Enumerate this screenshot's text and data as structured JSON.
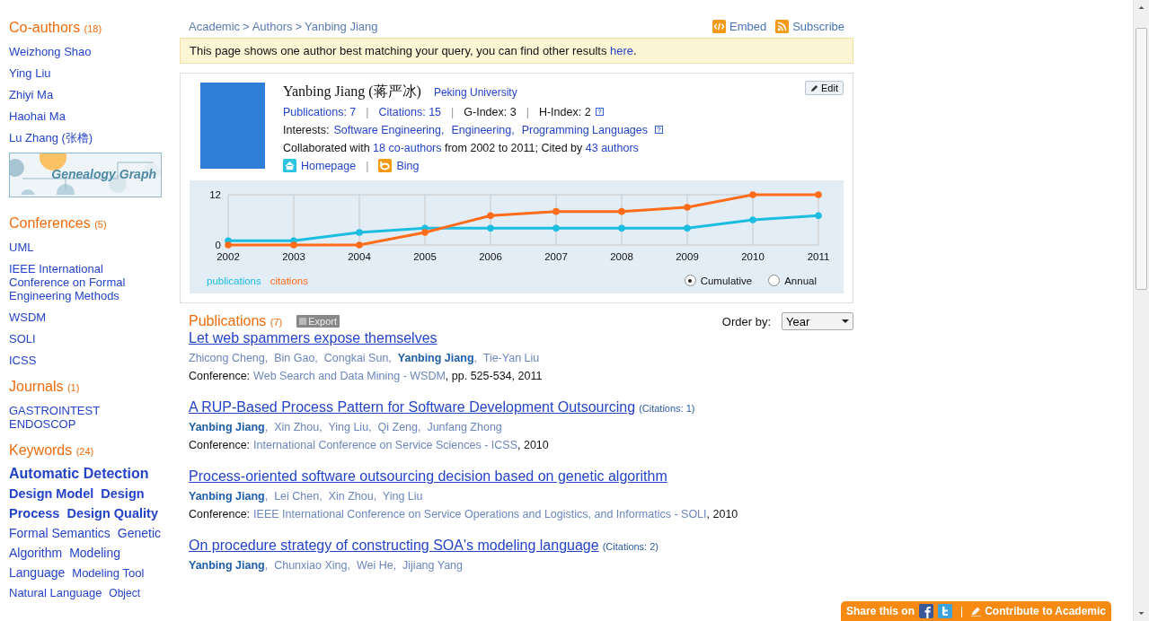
{
  "sidebar": {
    "coauthors": {
      "title": "Co-authors",
      "count": "(18)",
      "items": [
        "Weizhong Shao",
        "Ying Liu",
        "Zhiyi Ma",
        "Haohai Ma",
        "Lu Zhang (张橹)"
      ]
    },
    "genealogy": {
      "label": "Genealogy Graph"
    },
    "conferences": {
      "title": "Conferences",
      "count": "(5)",
      "items": [
        "UML",
        "IEEE International Conference on Formal Engineering Methods",
        "WSDM",
        "SOLI",
        "ICSS"
      ]
    },
    "journals": {
      "title": "Journals",
      "count": "(1)",
      "items": [
        "GASTROINTEST ENDOSCOP"
      ]
    },
    "keywords": {
      "title": "Keywords",
      "count": "(24)",
      "items": [
        {
          "text": "Automatic Detection",
          "kind": "xl"
        },
        {
          "text": "Design Model",
          "kind": "bold"
        },
        {
          "text": "Design",
          "kind": "bold"
        },
        {
          "text": "Process",
          "kind": "bold"
        },
        {
          "text": "Design Quality",
          "kind": "bold"
        },
        {
          "text": "Formal Semantics",
          "kind": "medium"
        },
        {
          "text": "Genetic",
          "kind": "medium"
        },
        {
          "text": "Algorithm",
          "kind": "medium"
        },
        {
          "text": "Modeling",
          "kind": "medium"
        },
        {
          "text": "Language",
          "kind": "medium"
        },
        {
          "text": "Modeling Tool",
          "kind": "small"
        },
        {
          "text": "Natural Language",
          "kind": "small"
        },
        {
          "text": "Object",
          "kind": "tiny"
        }
      ]
    }
  },
  "breadcrumb": {
    "items": [
      "Academic",
      "Authors",
      "Yanbing Jiang"
    ],
    "separator": ">"
  },
  "actions": [
    "Embed",
    "Subscribe"
  ],
  "notice": [
    {
      "kind": "text",
      "text": "This page shows one author best matching your query, you can find other results "
    },
    {
      "kind": "link",
      "text": "here"
    },
    {
      "kind": "text",
      "text": "."
    }
  ],
  "author": {
    "name": "Yanbing Jiang (蒋严冰)",
    "affiliation": "Peking University",
    "edit": "Edit",
    "stats": [
      {
        "text": "Publications: 7",
        "link": true
      },
      {
        "text": "Citations: 15",
        "link": true
      },
      {
        "text": "G-Index: 3",
        "link": false
      },
      {
        "text": "H-Index: 2",
        "link": false
      }
    ],
    "separator": "|",
    "interests_label": "Interests:",
    "interests": [
      "Software Engineering,",
      "Engineering,",
      "Programming Languages"
    ],
    "collab": [
      {
        "kind": "text",
        "text": "Collaborated with "
      },
      {
        "kind": "link",
        "text": "18 co-authors"
      },
      {
        "kind": "text",
        "text": " from 2002 to 2011; Cited by "
      },
      {
        "kind": "link",
        "text": "43 authors"
      }
    ],
    "links": [
      "Homepage",
      "Bing"
    ]
  },
  "chart": {
    "chart_data": {
      "type": "line",
      "x": [
        "2002",
        "2003",
        "2004",
        "2005",
        "2006",
        "2007",
        "2008",
        "2009",
        "2010",
        "2011"
      ],
      "ylim": [
        0,
        12
      ],
      "yticks": [
        0,
        12
      ],
      "grid": true,
      "series": [
        {
          "name": "publications",
          "color": "#1bbde0",
          "marker": true,
          "values": [
            1,
            1,
            3,
            4,
            4,
            4,
            4,
            4,
            6,
            7
          ]
        },
        {
          "name": "citations",
          "color": "#ff6c1a",
          "marker": true,
          "values": [
            0,
            0,
            0,
            3,
            7,
            8,
            8,
            9,
            12,
            12
          ]
        }
      ]
    },
    "modes": [
      {
        "label": "Cumulative",
        "selected": true
      },
      {
        "label": "Annual",
        "selected": false
      }
    ]
  },
  "publications": {
    "title": "Publications",
    "count": "(7)",
    "export": "Export",
    "order_label": "Order by:",
    "order_value": "Year",
    "items": [
      {
        "title": "Let web spammers expose themselves",
        "authors": "Zhicong Cheng,  Bin Gao,  Congkai Sun,  **Yanbing Jiang**,  Tie-Yan Liu",
        "venue_label": "Conference:",
        "venue": "Web Search and Data Mining - WSDM",
        "details": ", pp. 525-534, 2011"
      },
      {
        "title": "A RUP-Based Process Pattern for Software Development Outsourcing",
        "citations": "(Citations: 1)",
        "authors": "**Yanbing Jiang**,  Xin Zhou,  Ying Liu,  Qi Zeng,  Junfang Zhong",
        "venue_label": "Conference:",
        "venue": "International Conference on Service Sciences - ICSS",
        "details": ", 2010"
      },
      {
        "title": "Process-oriented software outsourcing decision based on genetic algorithm",
        "authors": "**Yanbing Jiang**,  Lei Chen,  Xin Zhou,  Ying Liu",
        "venue_label": "Conference:",
        "venue": "IEEE International Conference on Service Operations and Logistics, and Informatics - SOLI",
        "details": ", 2010"
      },
      {
        "title": "On procedure strategy of constructing SOA's modeling language",
        "citations": "(Citations: 2)",
        "authors": "**Yanbing Jiang**,  Chunxiao Xing,  Wei He,  Jijiang Yang"
      }
    ]
  },
  "footer": {
    "share": "Share this on",
    "separator": "|",
    "contribute": "Contribute to Academic"
  }
}
